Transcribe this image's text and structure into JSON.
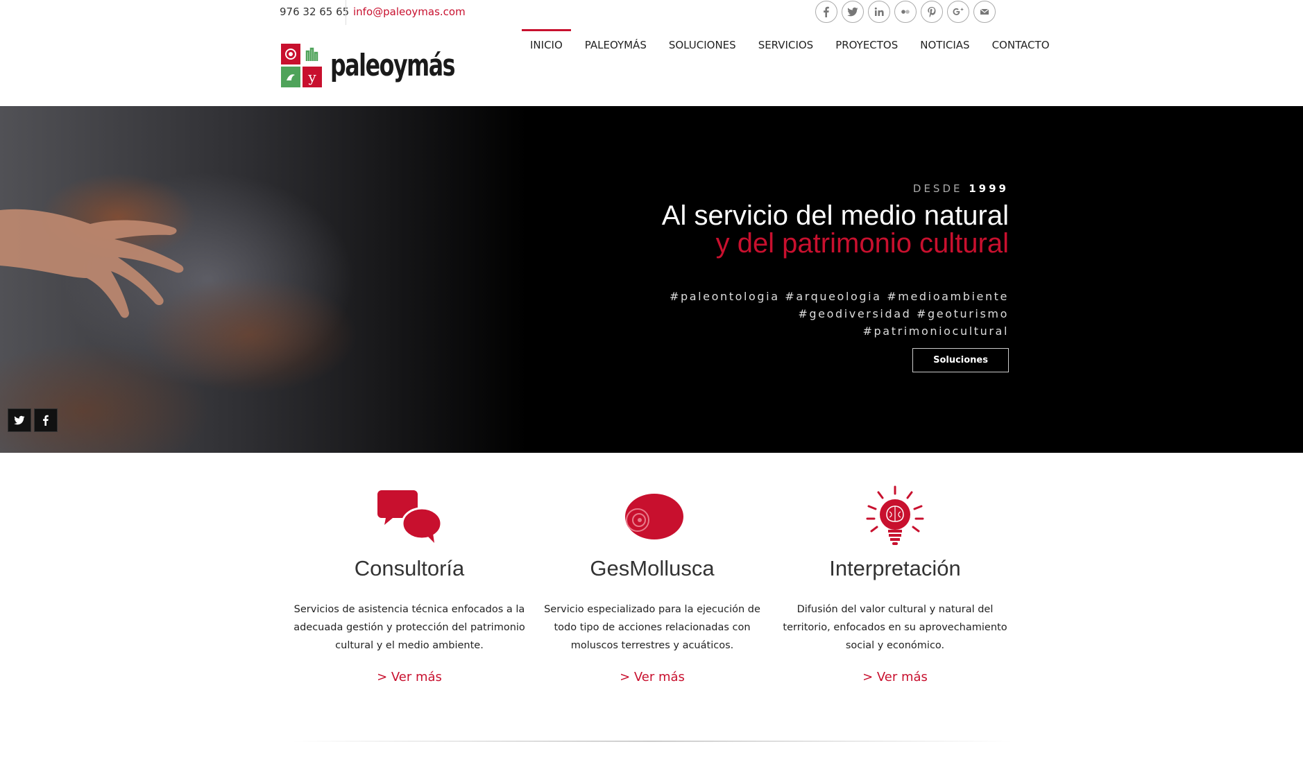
{
  "topbar": {
    "phone": "976 32 65 65",
    "email": "info@paleoymas.com",
    "socials": [
      "facebook-icon",
      "twitter-icon",
      "linkedin-icon",
      "flickr-icon",
      "pinterest-icon",
      "google-plus-icon",
      "email-icon"
    ]
  },
  "logo": {
    "text": "paleoymás",
    "y_letter": "y"
  },
  "nav": {
    "items": [
      "INICIO",
      "PALEOYMÁS",
      "SOLUCIONES",
      "SERVICIOS",
      "PROYECTOS",
      "NOTICIAS",
      "CONTACTO"
    ],
    "active": "INICIO"
  },
  "hero": {
    "desde_label": "DESDE",
    "desde_year": "1999",
    "headline_1": "Al servicio del medio natural",
    "headline_2": "y del patrimonio cultural",
    "tags_1": "#paleontologia #arqueologia #medioambiente",
    "tags_2": "#geodiversidad #geoturismo",
    "tags_3": "#patrimoniocultural",
    "button": "Soluciones"
  },
  "services": [
    {
      "title": "Consultoría",
      "desc": "Servicios de asistencia técnica enfocados a la adecuada gestión y protección del patrimonio cultural y el medio ambiente.",
      "link": "> Ver más"
    },
    {
      "title": "GesMollusca",
      "desc": "Servicio especializado para la ejecución de todo tipo de acciones relacionadas con moluscos terrestres y acuáticos.",
      "link": "> Ver más"
    },
    {
      "title": "Interpretación",
      "desc": "Difusión del valor cultural y natural del territorio, enfocados en su aprovechamiento social y económico.",
      "link": "> Ver más"
    }
  ],
  "colors": {
    "accent": "#c8102e",
    "green": "#4fa35a"
  }
}
